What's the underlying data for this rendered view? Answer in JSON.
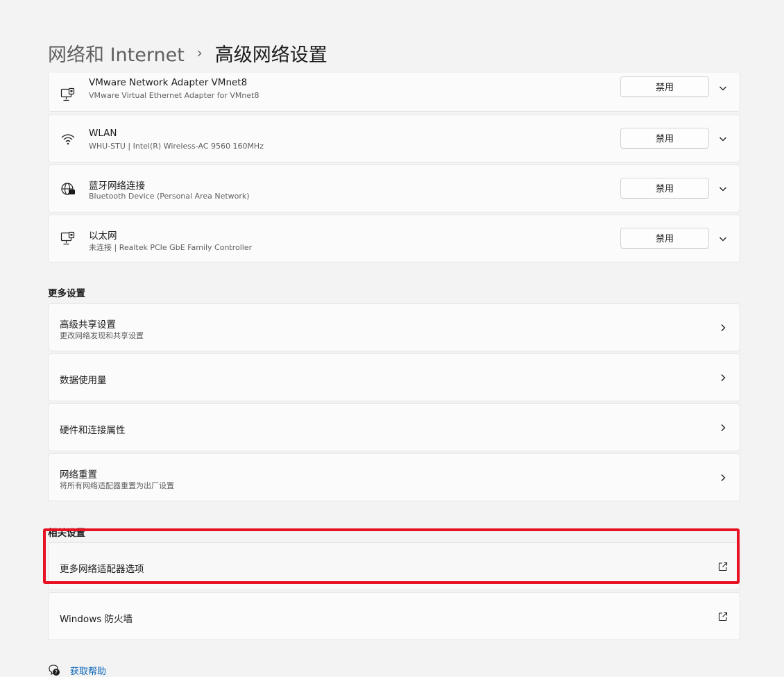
{
  "breadcrumb": {
    "parent": "网络和 Internet",
    "separator": "›",
    "current": "高级网络设置"
  },
  "adapters": [
    {
      "name": "VMware Network Adapter VMnet8",
      "description": "VMware Virtual Ethernet Adapter for VMnet8",
      "button": "禁用",
      "icon": "ethernet-icon"
    },
    {
      "name": "WLAN",
      "description": "WHU-STU | Intel(R) Wireless-AC 9560 160MHz",
      "button": "禁用",
      "icon": "wifi-icon"
    },
    {
      "name": "蓝牙网络连接",
      "description": "Bluetooth Device (Personal Area Network)",
      "button": "禁用",
      "icon": "globe-icon"
    },
    {
      "name": "以太网",
      "description": "未连接 | Realtek PCIe GbE Family Controller",
      "button": "禁用",
      "icon": "ethernet-icon"
    }
  ],
  "more_settings": {
    "label": "更多设置",
    "items": [
      {
        "title": "高级共享设置",
        "subtitle": "更改网络发现和共享设置"
      },
      {
        "title": "数据使用量"
      },
      {
        "title": "硬件和连接属性"
      },
      {
        "title": "网络重置",
        "subtitle": "将所有网络适配器重置为出厂设置"
      }
    ]
  },
  "related_settings": {
    "label": "相关设置",
    "items": [
      {
        "title": "更多网络适配器选项",
        "icon": "external-link-icon"
      },
      {
        "title": "Windows 防火墙",
        "icon": "external-link-icon"
      }
    ]
  },
  "help": {
    "label": "获取帮助",
    "icon": "help-icon"
  },
  "colors": {
    "highlight": "#e81123",
    "link": "#005fb8",
    "background": "#f3f3f3",
    "card": "#fbfbfb"
  }
}
